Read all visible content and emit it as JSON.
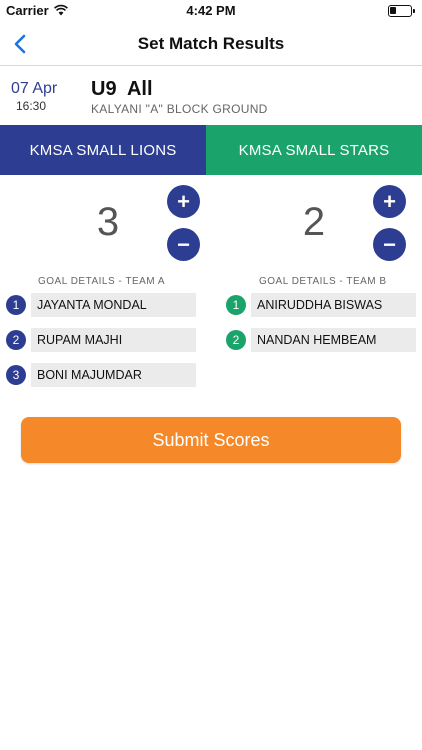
{
  "status": {
    "carrier": "Carrier",
    "time": "4:42 PM",
    "battery_level": 0.3
  },
  "nav": {
    "title": "Set Match Results",
    "back_icon": "chevron-left-icon"
  },
  "match": {
    "date": "07 Apr",
    "time": "16:30",
    "category": "U9  All",
    "venue": "KALYANI \"A\" BLOCK GROUND"
  },
  "teams": {
    "a": {
      "name": "KMSA SMALL LIONS",
      "score": "3",
      "goals_header": "GOAL DETAILS - TEAM A",
      "color": "#2d3e92"
    },
    "b": {
      "name": "KMSA SMALL STARS",
      "score": "2",
      "goals_header": "GOAL DETAILS - TEAM B",
      "color": "#1aa36a"
    }
  },
  "controls": {
    "plus": "+",
    "minus": "−"
  },
  "goals_a": [
    {
      "num": "1",
      "scorer": "JAYANTA MONDAL"
    },
    {
      "num": "2",
      "scorer": "RUPAM MAJHI"
    },
    {
      "num": "3",
      "scorer": "BONI MAJUMDAR"
    }
  ],
  "goals_b": [
    {
      "num": "1",
      "scorer": "ANIRUDDHA BISWAS"
    },
    {
      "num": "2",
      "scorer": "NANDAN HEMBEAM"
    }
  ],
  "submit": {
    "label": "Submit Scores",
    "color": "#f5892a"
  }
}
